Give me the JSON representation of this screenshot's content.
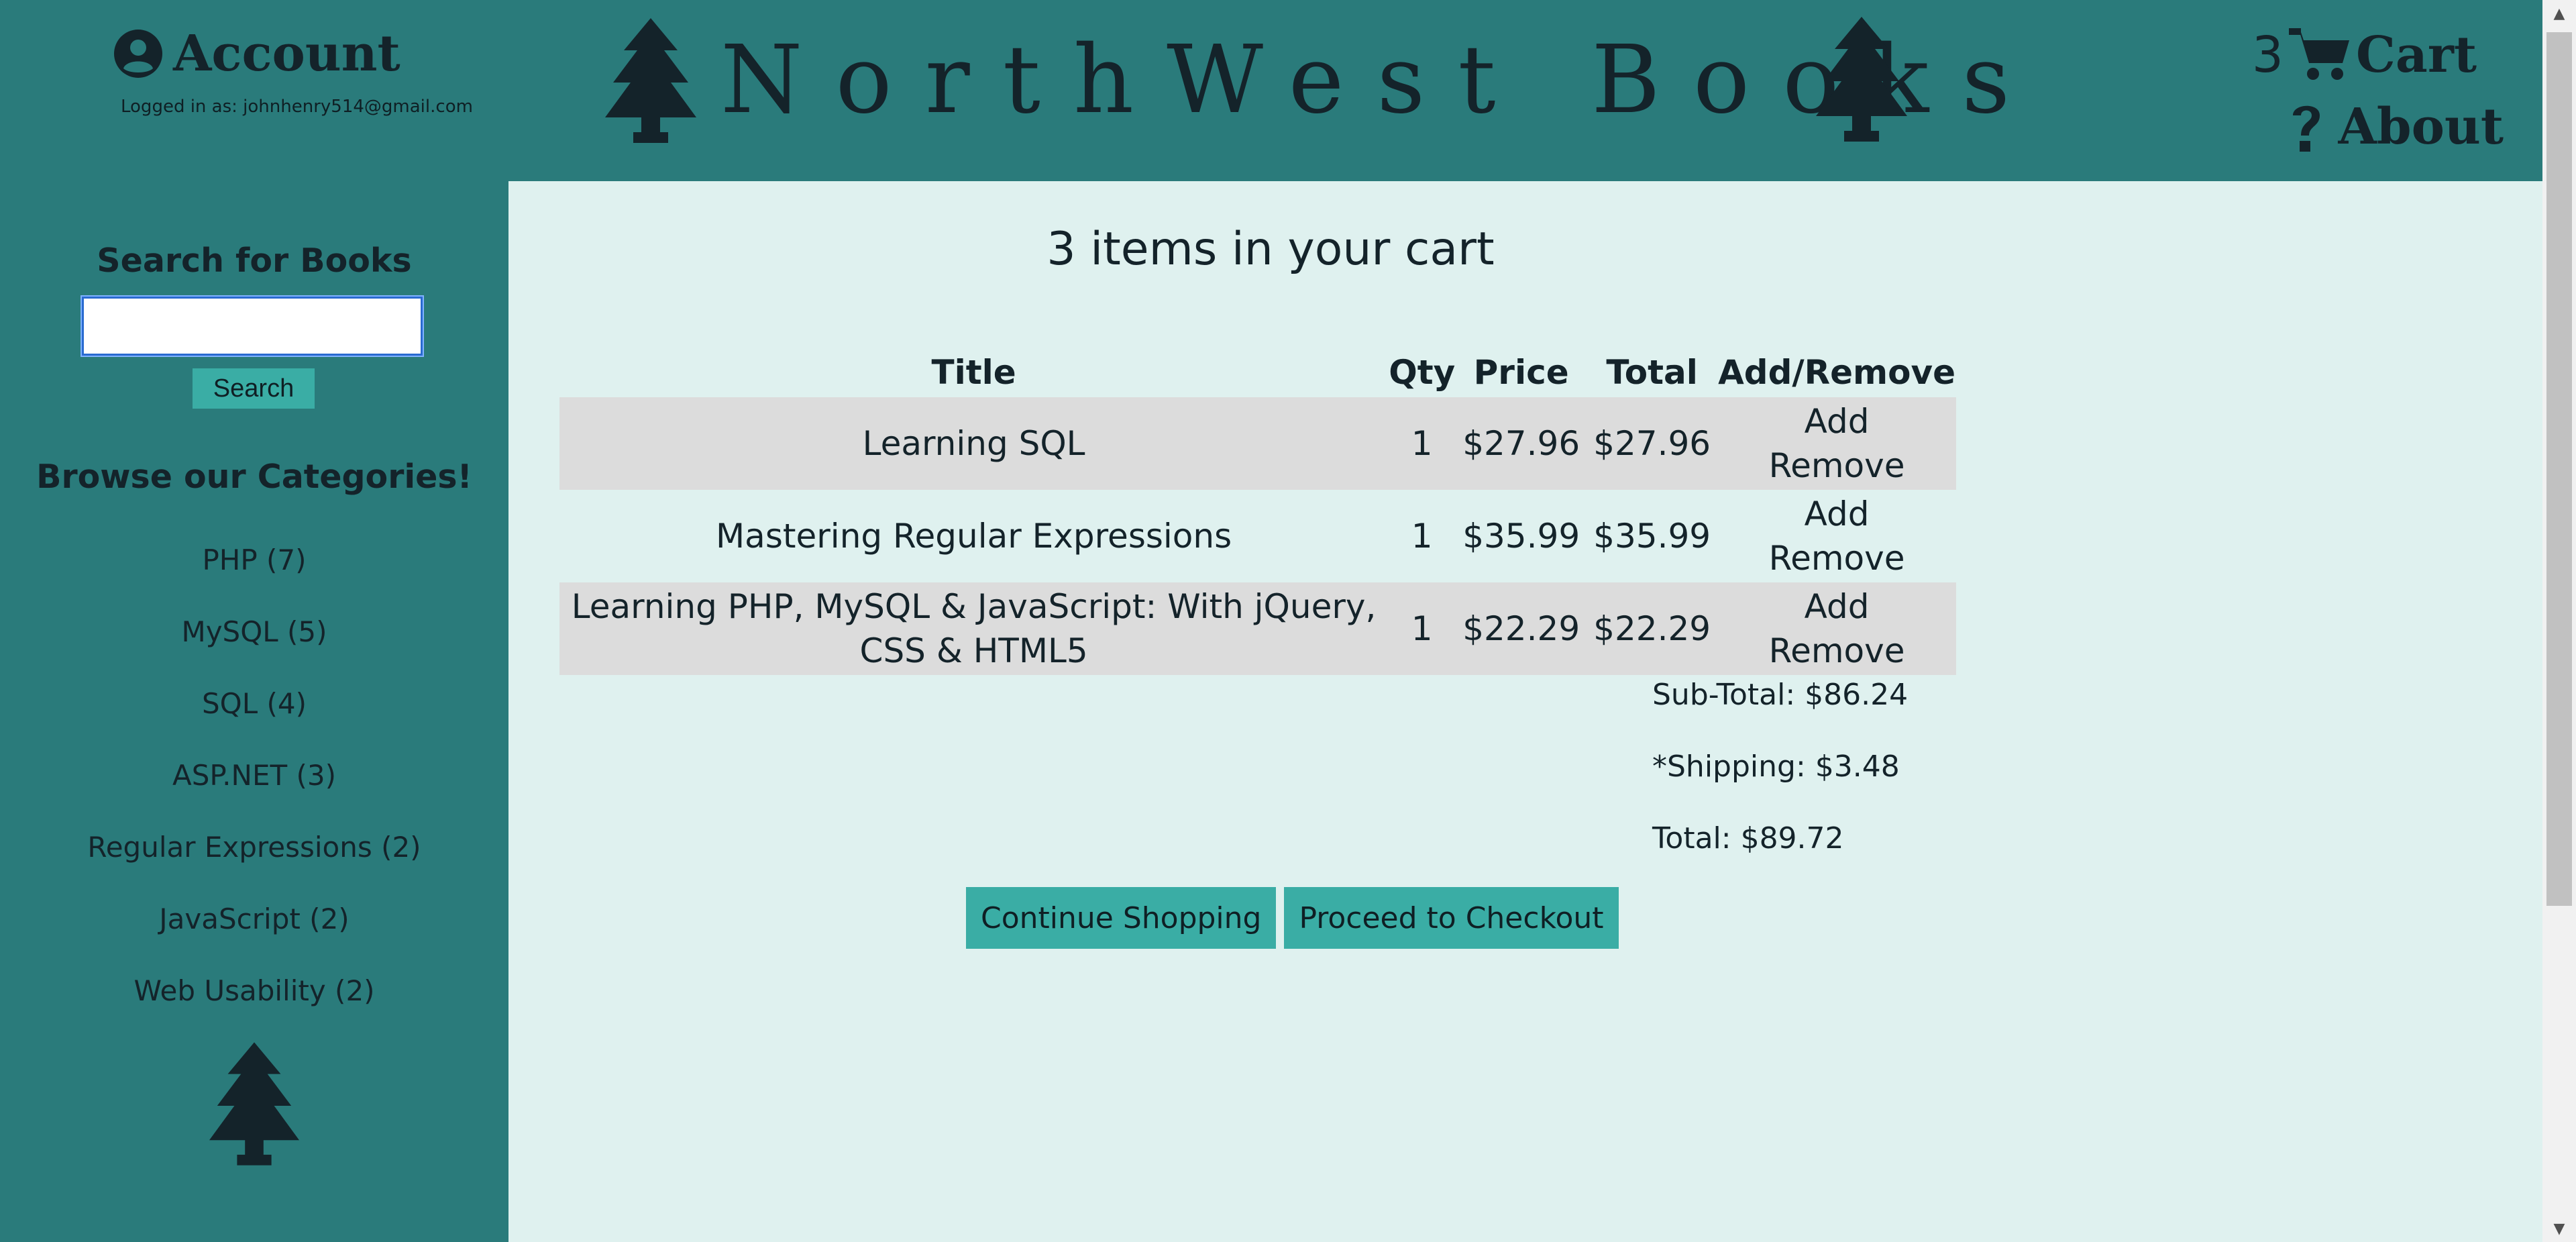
{
  "header": {
    "account_label": "Account",
    "logged_in_text": "Logged in as: johnhenry514@gmail.com",
    "brand_name": "NorthWest Books",
    "cart_count": "3",
    "cart_label": "Cart",
    "about_label": "About"
  },
  "sidebar": {
    "search_heading": "Search for Books",
    "search_value": "",
    "search_button": "Search",
    "categories_heading": "Browse our Categories!",
    "categories": [
      {
        "label": "PHP (7)"
      },
      {
        "label": "MySQL (5)"
      },
      {
        "label": "SQL (4)"
      },
      {
        "label": "ASP.NET (3)"
      },
      {
        "label": "Regular Expressions (2)"
      },
      {
        "label": "JavaScript (2)"
      },
      {
        "label": "Web Usability (2)"
      }
    ]
  },
  "cart": {
    "heading": "3 items in your cart",
    "columns": [
      "Title",
      "Qty",
      "Price",
      "Total",
      "Add/Remove"
    ],
    "add_label": "Add",
    "remove_label": "Remove",
    "items": [
      {
        "title": "Learning SQL",
        "qty": "1",
        "price": "$27.96",
        "total": "$27.96"
      },
      {
        "title": "Mastering Regular Expressions",
        "qty": "1",
        "price": "$35.99",
        "total": "$35.99"
      },
      {
        "title": "Learning PHP, MySQL & JavaScript: With jQuery, CSS & HTML5",
        "qty": "1",
        "price": "$22.29",
        "total": "$22.29"
      }
    ],
    "subtotal": "Sub-Total: $86.24",
    "shipping": "*Shipping: $3.48",
    "grand_total": "Total: $89.72",
    "continue_button": "Continue Shopping",
    "checkout_button": "Proceed to Checkout"
  },
  "colors": {
    "header_bg": "#2a7b7b",
    "main_bg": "#dff1ef",
    "button_bg": "#3aada5",
    "row_shade": "#dcdcdc",
    "text_dark": "#14232a"
  },
  "icons": [
    "user-circle-icon",
    "pine-tree-icon",
    "cart-icon",
    "question-icon"
  ]
}
